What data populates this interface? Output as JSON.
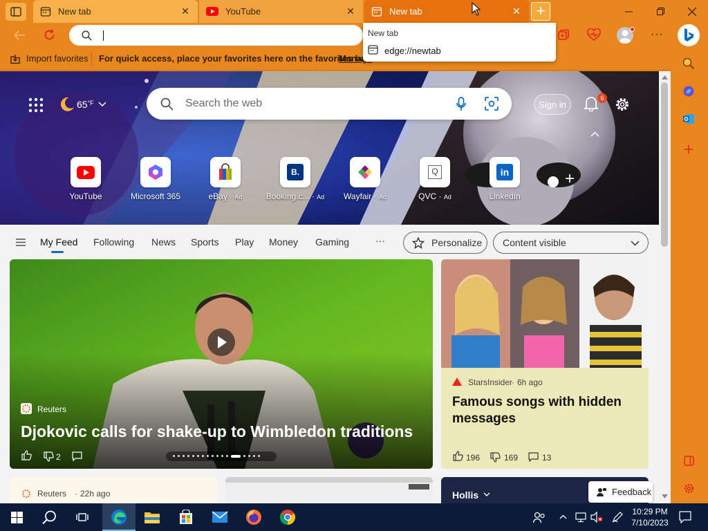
{
  "tabs": [
    {
      "title": "New tab"
    },
    {
      "title": "YouTube"
    },
    {
      "title": "New tab"
    }
  ],
  "address": {
    "value": ""
  },
  "popup": {
    "header": "New tab",
    "suggestion": "edge://newtab"
  },
  "favbar": {
    "import_label": "Import favorites",
    "message": "For quick access, place your favorites here on the favorites bar.",
    "manage_link": "Manage"
  },
  "weather": {
    "temp": "65",
    "unit": "°F"
  },
  "search": {
    "placeholder": "Search the web"
  },
  "header": {
    "signin": "Sign in",
    "notif_count": "6"
  },
  "quicklinks": [
    {
      "label": "YouTube",
      "ad": ""
    },
    {
      "label": "Microsoft 365",
      "ad": ""
    },
    {
      "label": "eBay",
      "ad": "Ad"
    },
    {
      "label": "Booking.c...",
      "ad": "Ad"
    },
    {
      "label": "Wayfair",
      "ad": "Ad"
    },
    {
      "label": "QVC",
      "ad": "Ad"
    },
    {
      "label": "LinkedIn",
      "ad": ""
    }
  ],
  "feed_tabs": [
    "My Feed",
    "Following",
    "News",
    "Sports",
    "Play",
    "Money",
    "Gaming"
  ],
  "feed_more": "···",
  "personalize_label": "Personalize",
  "content_visible_label": "Content visible",
  "main_card": {
    "source": "Reuters",
    "headline": "Djokovic calls for shake-up to Wimbledon traditions",
    "dislikes": "2"
  },
  "side_card": {
    "source": "StarsInsider",
    "time": "6h ago",
    "headline": "Famous songs with hidden messages",
    "likes": "196",
    "dislikes": "169",
    "comments": "13"
  },
  "bottom_card1": {
    "source": "Reuters",
    "time": "22h ago"
  },
  "bottom_card3": {
    "label": "Hollis"
  },
  "feedback_label": "Feedback",
  "taskbar": {
    "time": "10:29 PM",
    "date": "7/10/2023"
  },
  "colors": {
    "frame": "#e8871e",
    "active_tab": "#e5720c",
    "edge_accent": "#0f6cbd"
  }
}
